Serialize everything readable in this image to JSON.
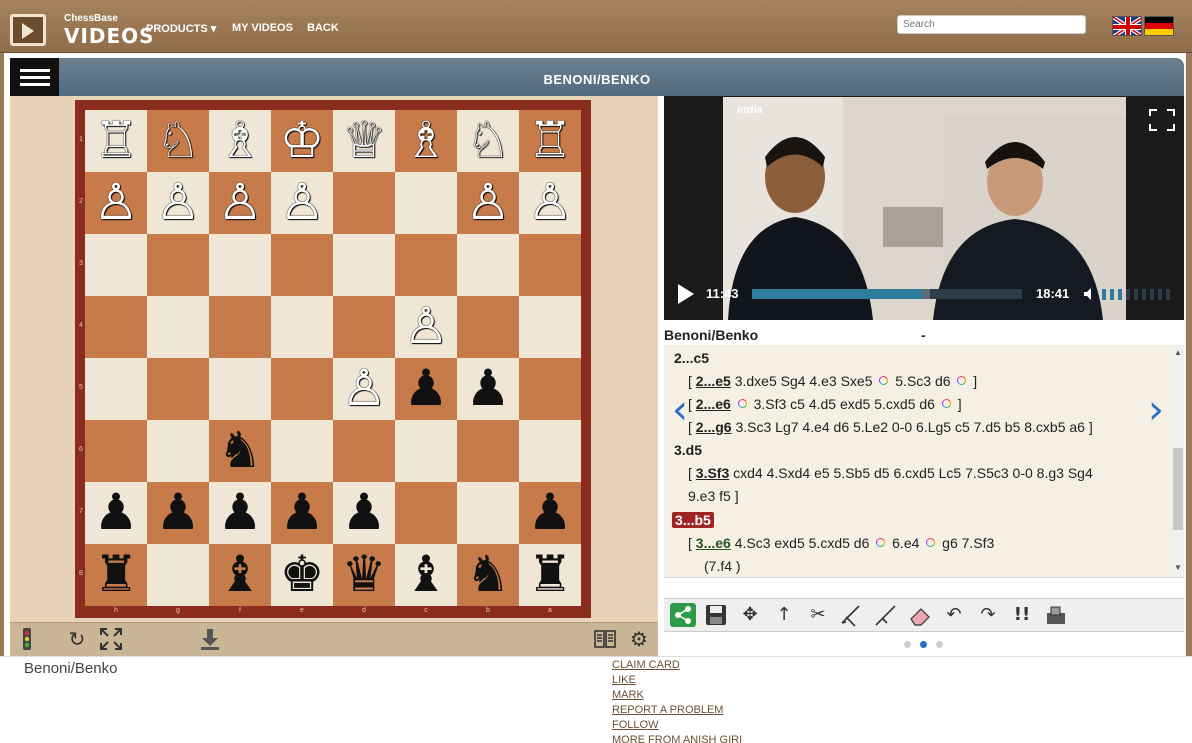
{
  "header": {
    "brand_small": "ChessBase",
    "brand_big": "VIDEOS",
    "nav": [
      {
        "label": "PRODUCTS ▾"
      },
      {
        "label": "MY VIDEOS"
      },
      {
        "label": "BACK"
      }
    ],
    "search_placeholder": "Search"
  },
  "title_bar": {
    "title": "BENONI/BENKO"
  },
  "board": {
    "ranks": [
      "1",
      "2",
      "3",
      "4",
      "5",
      "6",
      "7",
      "8"
    ],
    "files": [
      "h",
      "g",
      "f",
      "e",
      "d",
      "c",
      "b",
      "a"
    ],
    "pieces": [
      {
        "sq": "r1c1",
        "glyph": "♖",
        "color": "w"
      },
      {
        "sq": "r1c2",
        "glyph": "♘",
        "color": "w"
      },
      {
        "sq": "r1c3",
        "glyph": "♗",
        "color": "w"
      },
      {
        "sq": "r1c4",
        "glyph": "♔",
        "color": "w"
      },
      {
        "sq": "r1c5",
        "glyph": "♕",
        "color": "w"
      },
      {
        "sq": "r1c6",
        "glyph": "♗",
        "color": "w"
      },
      {
        "sq": "r1c7",
        "glyph": "♘",
        "color": "w"
      },
      {
        "sq": "r1c8",
        "glyph": "♖",
        "color": "w"
      },
      {
        "sq": "r2c1",
        "glyph": "♙",
        "color": "w"
      },
      {
        "sq": "r2c2",
        "glyph": "♙",
        "color": "w"
      },
      {
        "sq": "r2c3",
        "glyph": "♙",
        "color": "w"
      },
      {
        "sq": "r2c4",
        "glyph": "♙",
        "color": "w"
      },
      {
        "sq": "r2c7",
        "glyph": "♙",
        "color": "w"
      },
      {
        "sq": "r2c8",
        "glyph": "♙",
        "color": "w"
      },
      {
        "sq": "r4c6",
        "glyph": "♙",
        "color": "w"
      },
      {
        "sq": "r5c5",
        "glyph": "♙",
        "color": "w"
      },
      {
        "sq": "r5c6",
        "glyph": "♟",
        "color": "b"
      },
      {
        "sq": "r5c7",
        "glyph": "♟",
        "color": "b"
      },
      {
        "sq": "r6c3",
        "glyph": "♞",
        "color": "b"
      },
      {
        "sq": "r7c1",
        "glyph": "♟",
        "color": "b"
      },
      {
        "sq": "r7c2",
        "glyph": "♟",
        "color": "b"
      },
      {
        "sq": "r7c3",
        "glyph": "♟",
        "color": "b"
      },
      {
        "sq": "r7c4",
        "glyph": "♟",
        "color": "b"
      },
      {
        "sq": "r7c5",
        "glyph": "♟",
        "color": "b"
      },
      {
        "sq": "r7c8",
        "glyph": "♟",
        "color": "b"
      },
      {
        "sq": "r8c1",
        "glyph": "♜",
        "color": "b"
      },
      {
        "sq": "r8c3",
        "glyph": "♝",
        "color": "b"
      },
      {
        "sq": "r8c4",
        "glyph": "♚",
        "color": "b"
      },
      {
        "sq": "r8c5",
        "glyph": "♛",
        "color": "b"
      },
      {
        "sq": "r8c6",
        "glyph": "♝",
        "color": "b"
      },
      {
        "sq": "r8c7",
        "glyph": "♞",
        "color": "b"
      },
      {
        "sq": "r8c8",
        "glyph": "♜",
        "color": "b"
      }
    ]
  },
  "video": {
    "overlay_text": "India",
    "current_time": "11:43",
    "total_time": "18:41",
    "progress": 0.63,
    "buffered": 0.66,
    "volume_level": 0.35
  },
  "notation": {
    "game_title": "Benoni/Benko",
    "game_subtitle": "-",
    "lines": {
      "l1": "2...c5",
      "l2a": "[ ",
      "l2m": "2...e5",
      "l2b": " 3.dxe5 Sg4 4.e3 Sxe5 ",
      "l2c": " 5.Sc3 d6 ",
      "l2d": " ]",
      "l3a": "[ ",
      "l3m": "2...e6",
      "l3b": " 3.Sf3 c5 4.d5 exd5 5.cxd5 d6 ",
      "l3d": " ]",
      "l4a": "[ ",
      "l4m": "2...g6",
      "l4b": " 3.Sc3 Lg7 4.e4 d6 5.Le2 0-0 6.Lg5 c5 7.d5 b5 8.cxb5 a6 ]",
      "l5": "3.d5",
      "l6a": "[ ",
      "l6m": "3.Sf3",
      "l6b": " cxd4 4.Sxd4 e5 5.Sb5 d5 6.cxd5 Lc5 7.S5c3 0-0 8.g3 Sg4",
      "l7": "9.e3 f5 ]",
      "l8": "3...b5",
      "l9a": "[ ",
      "l9m": "3...e6",
      "l9b": " 4.Sc3 exd5 5.cxd5 d6 ",
      "l9c": " 6.e4 ",
      "l9d": " g6 7.Sf3",
      "l10": "(7.f4 )"
    }
  },
  "bottom": {
    "title": "Benoni/Benko",
    "links": [
      "CLAIM CARD",
      "LIKE",
      "MARK",
      "REPORT A PROBLEM",
      "FOLLOW",
      "MORE FROM ANISH GIRI"
    ]
  },
  "colors": {
    "header_bg": "#9c7a55",
    "title_bg": "#5e7486",
    "board_dark": "#c77b4a",
    "board_light": "#f0e6d6",
    "current_move": "#a12424",
    "accent_blue": "#2a6fc9"
  }
}
